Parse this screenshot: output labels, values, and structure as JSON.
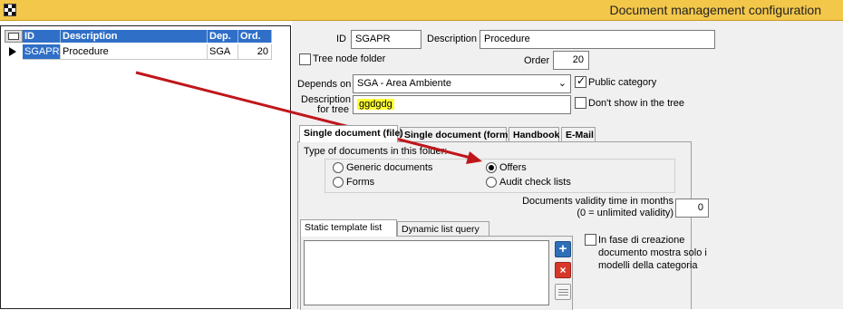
{
  "window": {
    "title": "Document management configuration",
    "icon": "checkered-app-icon"
  },
  "grid": {
    "columns": [
      "ID",
      "Description",
      "Dep.",
      "Ord."
    ],
    "rows": [
      {
        "id": "SGAPR",
        "description": "Procedure",
        "dep": "SGA",
        "ord": "20"
      }
    ]
  },
  "form": {
    "id_label": "ID",
    "id_value": "SGAPR",
    "description_label": "Description",
    "description_value": "Procedure",
    "tree_node_folder_label": "Tree node folder",
    "tree_node_folder_checked": false,
    "order_label": "Order",
    "order_value": "20",
    "depends_on_label": "Depends on",
    "depends_on_value": "SGA - Area Ambiente",
    "public_category_label": "Public category",
    "public_category_checked": true,
    "desc_for_tree_label_1": "Description",
    "desc_for_tree_label_2": "for tree",
    "desc_for_tree_value": "ggdgdg",
    "desc_for_tree_highlight": "#ffff33",
    "dont_show_label": "Don't show in the tree",
    "dont_show_checked": false
  },
  "tabs": [
    {
      "label": "Single document (file)",
      "active": true
    },
    {
      "label": "Single document (form)",
      "active": false
    },
    {
      "label": "Handbook",
      "active": false
    },
    {
      "label": "E-Mail",
      "active": false
    }
  ],
  "doc_types": {
    "group_label": "Type of documents in this folder:",
    "options": [
      {
        "label": "Generic documents",
        "selected": false
      },
      {
        "label": "Forms",
        "selected": false
      },
      {
        "label": "Offers",
        "selected": true
      },
      {
        "label": "Audit check lists",
        "selected": false
      }
    ]
  },
  "validity": {
    "label_1": "Documents validity time in months",
    "label_2": "(0 = unlimited validity)",
    "value": "0"
  },
  "template_tabs": [
    {
      "label": "Static template list",
      "active": true
    },
    {
      "label": "Dynamic list query",
      "active": false
    }
  ],
  "template_buttons": {
    "add": "plus-icon",
    "remove": "red-x-icon",
    "doc": "document-icon"
  },
  "creation_option": {
    "label_lines": [
      "In fase di creazione",
      "documento mostra solo i",
      "modelli della categoria"
    ],
    "checked": false
  },
  "colors": {
    "title_bar": "#f3c74a",
    "grid_header": "#2f6fc7",
    "annotation_arrow": "#c0161b"
  }
}
